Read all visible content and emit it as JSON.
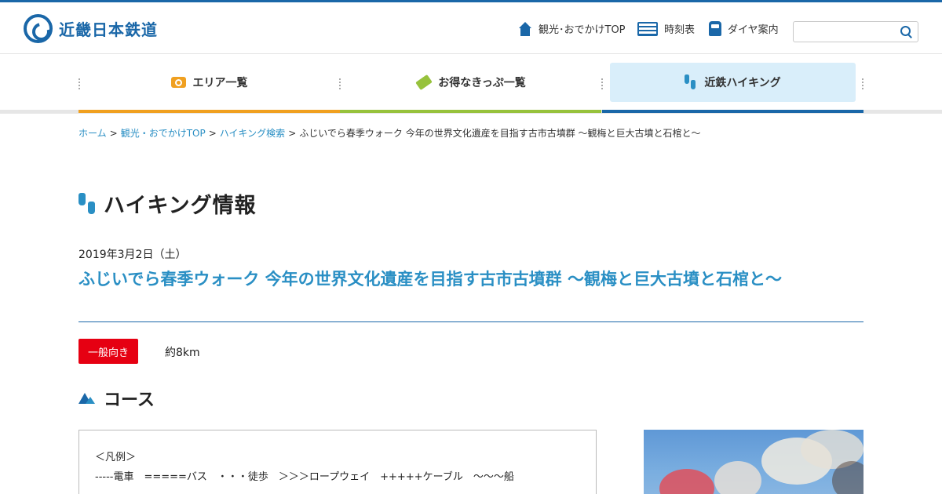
{
  "header": {
    "logo_text": "近畿日本鉄道",
    "utility": [
      {
        "label": "観光･おでかけTOP",
        "icon": "house-icon"
      },
      {
        "label": "時刻表",
        "icon": "timetable-icon"
      },
      {
        "label": "ダイヤ案内",
        "icon": "train-icon"
      }
    ],
    "search_placeholder": ""
  },
  "nav": [
    {
      "label": "エリア一覧",
      "icon": "camera-icon",
      "color": "#f0a020"
    },
    {
      "label": "お得なきっぷ一覧",
      "icon": "ticket-icon",
      "color": "#97c23c"
    },
    {
      "label": "近鉄ハイキング",
      "icon": "footsteps-icon",
      "color": "#1a67a8",
      "active": true
    }
  ],
  "breadcrumb": {
    "home": "ホーム",
    "top": "観光・おでかけTOP",
    "search": "ハイキング検索",
    "current": "ふじいでら春季ウォーク 今年の世界文化遺産を目指す古市古墳群 ～観梅と巨大古墳と石棺と～"
  },
  "page": {
    "heading": "ハイキング情報",
    "date": "2019年3月2日（土）",
    "event_title": "ふじいでら春季ウォーク 今年の世界文化遺産を目指す古市古墳群 ～観梅と巨大古墳と石棺と～",
    "level_badge": "一般向き",
    "distance": "約8km",
    "course_heading": "コース",
    "legend_title": "＜凡例＞",
    "legend_line": "-----電車　=====バス　・・・徒歩　＞＞＞ロープウェイ　+++++ケーブル　〜〜〜船"
  },
  "colors": {
    "brand": "#1a67a8",
    "accent_blue": "#2a8fc4",
    "badge_red": "#e60012"
  }
}
